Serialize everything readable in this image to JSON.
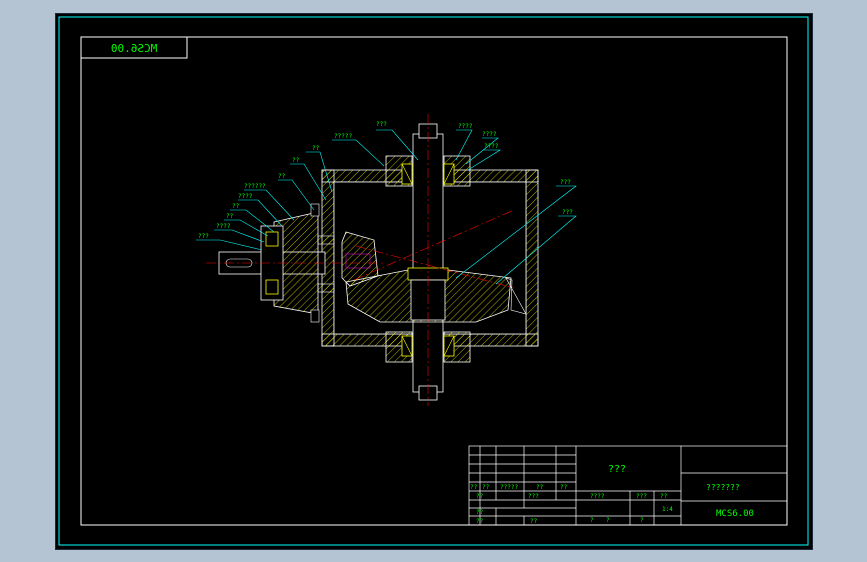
{
  "drawing": {
    "code_stamp": "MCS6.00",
    "callouts": [
      "???",
      "??",
      "?????",
      "????",
      "??",
      "??",
      "??????",
      "????",
      "??",
      "??",
      "????",
      "???",
      "????",
      "???",
      "????",
      "?????",
      "???"
    ]
  },
  "title_block": {
    "part_name": "???",
    "school": "???????",
    "drawing_no": "MCS6.00",
    "row1": [
      "??",
      "??",
      "?????",
      "??",
      "??"
    ],
    "row2_a": "??",
    "row2_b": "???",
    "row2_c": "????",
    "row2_d": "???",
    "row2_e": "??",
    "row3_a": "??",
    "row3_b": "??",
    "scale": "1:4",
    "q1": "?",
    "q2": "?",
    "q3": "?"
  },
  "colors": {
    "frame": "#ffffff",
    "border": "#00ffff",
    "centerline": "#ff0000",
    "text": "#00ff00",
    "part": "#ffff00",
    "hatch": "#ffff00"
  }
}
